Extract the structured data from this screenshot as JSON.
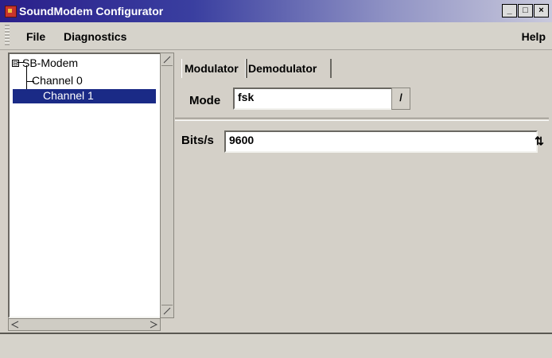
{
  "window": {
    "title": "SoundModem Configurator",
    "controls": [
      "_",
      "□",
      "×"
    ]
  },
  "menubar": {
    "file": "File",
    "diagnostics": "Diagnostics",
    "help": "Help"
  },
  "tree": {
    "root": "SB-Modem",
    "expander": "⊟",
    "items": [
      {
        "label": "Channel 0",
        "selected": false
      },
      {
        "label": "Channel 1",
        "selected": true
      }
    ]
  },
  "tabs": [
    {
      "label": "Modulator",
      "active": true
    },
    {
      "label": "Demodulator",
      "active": false
    }
  ],
  "modulator": {
    "mode_label": "Mode",
    "mode_value": "fsk",
    "mode_button": "/",
    "bits_label": "Bits/s",
    "bits_value": "9600",
    "bits_arrow": "⇅"
  },
  "colors": {
    "selection": "#1a2a86",
    "titlebar_start": "#2a1f8a",
    "background": "#d4d0c8"
  }
}
